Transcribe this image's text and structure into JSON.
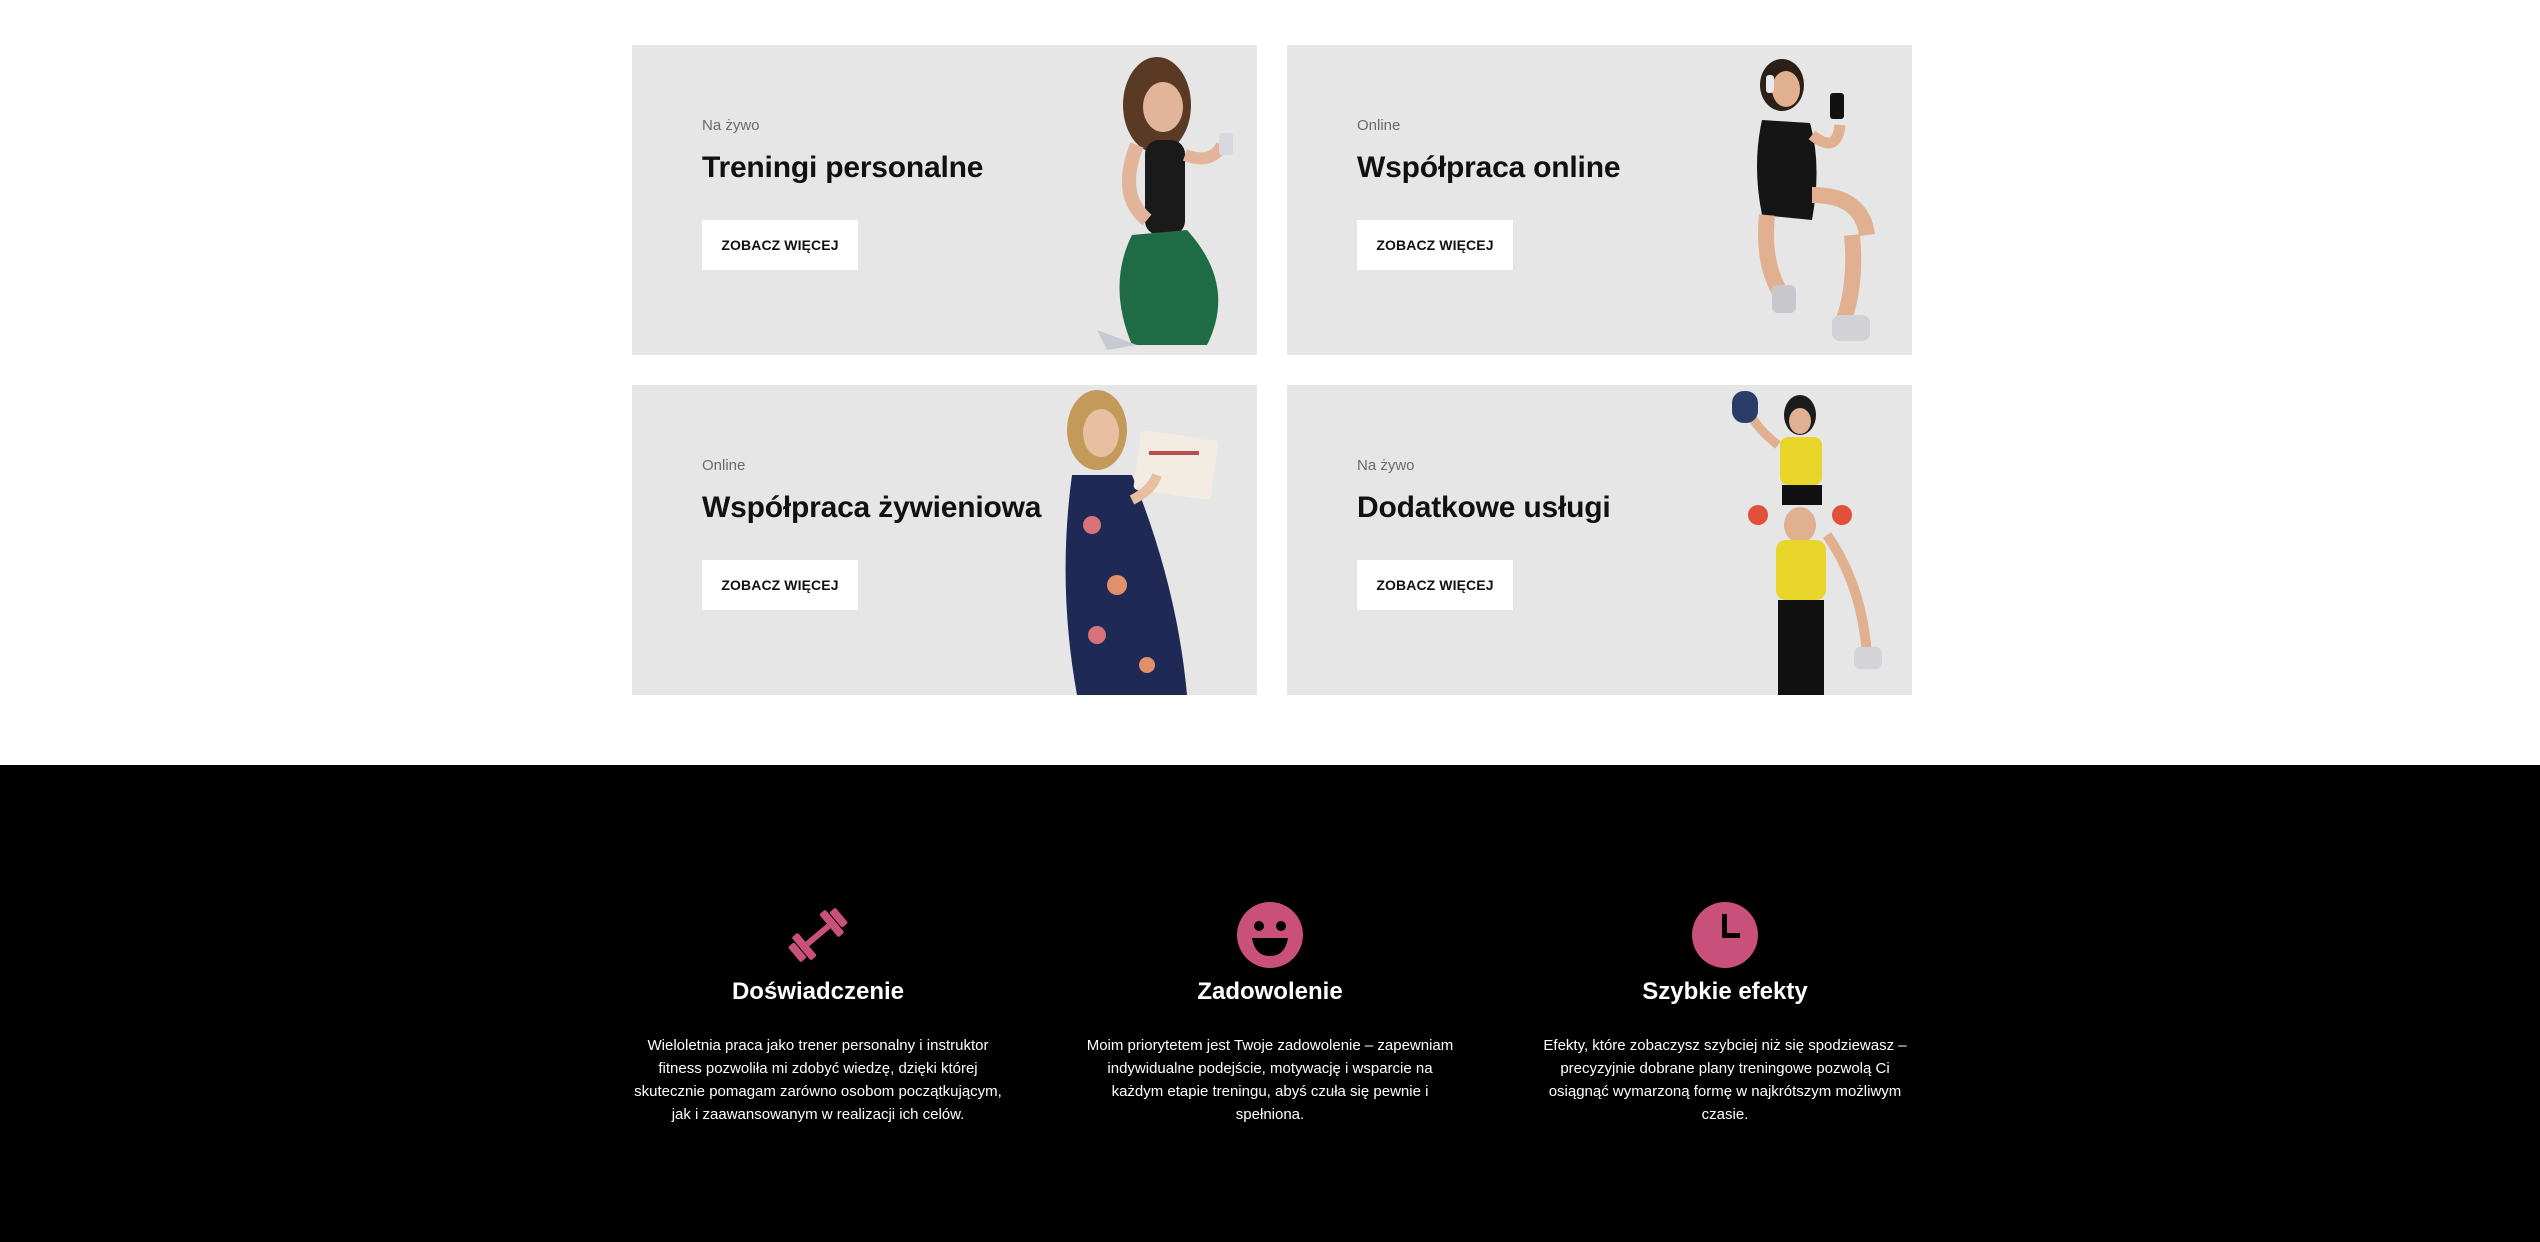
{
  "cards": [
    {
      "tag": "Na żywo",
      "title": "Treningi personalne",
      "button": "ZOBACZ WIĘCEJ"
    },
    {
      "tag": "Online",
      "title": "Współpraca online",
      "button": "ZOBACZ WIĘCEJ"
    },
    {
      "tag": "Online",
      "title": "Współpraca żywieniowa",
      "button": "ZOBACZ WIĘCEJ"
    },
    {
      "tag": "Na żywo",
      "title": "Dodatkowe usługi",
      "button": "ZOBACZ WIĘCEJ"
    }
  ],
  "features": [
    {
      "icon": "dumbbell-icon",
      "title": "Doświadczenie",
      "text": "Wieloletnia praca jako trener personalny i instruktor fitness pozwoliła mi zdobyć wiedzę, dzięki której skutecznie pomagam zarówno osobom początkującym, jak i zaawansowanym w realizacji ich celów."
    },
    {
      "icon": "smile-icon",
      "title": "Zadowolenie",
      "text": "Moim priorytetem jest Twoje zadowolenie – zapewniam indywidualne podejście, motywację i wsparcie na każdym etapie treningu, abyś czuła się pewnie i spełniona."
    },
    {
      "icon": "clock-icon",
      "title": "Szybkie efekty",
      "text": "Efekty, które zobaczysz szybciej niż się spodziewasz – precyzyjnie dobrane plany treningowe pozwolą Ci osiągnąć wymarzoną formę w najkrótszym możliwym czasie."
    }
  ],
  "colors": {
    "accent": "#c8507a",
    "card_bg": "#e6e6e6",
    "dark_bg": "#000000"
  }
}
